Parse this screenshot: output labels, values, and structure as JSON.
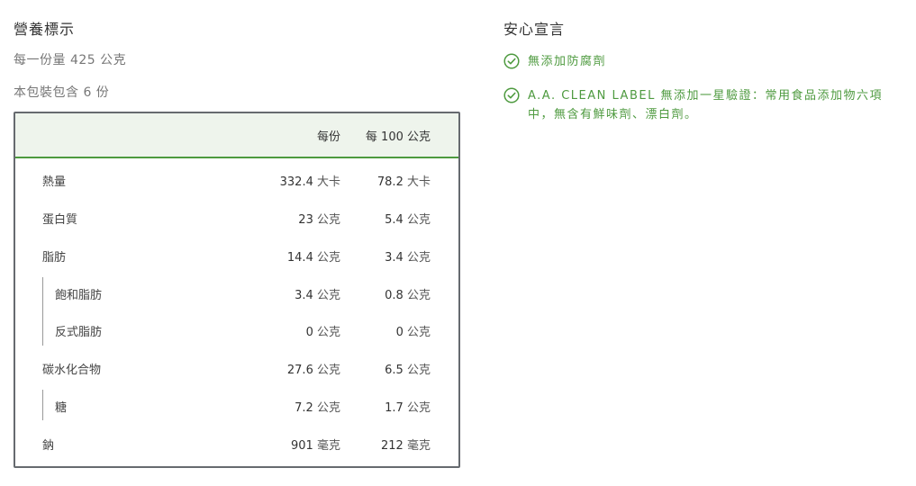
{
  "nutrition": {
    "title": "營養標示",
    "serving_size": "每一份量 425 公克",
    "servings": "本包裝包含 6 份",
    "headers": {
      "per_serving": "每份",
      "per_100g": "每 100 公克"
    },
    "rows": [
      {
        "name": "熱量",
        "per_serving": "332.4",
        "per_serving_unit": "大卡",
        "per_100g": "78.2",
        "per_100g_unit": "大卡"
      },
      {
        "name": "蛋白質",
        "per_serving": "23",
        "per_serving_unit": "公克",
        "per_100g": "5.4",
        "per_100g_unit": "公克"
      },
      {
        "name": "脂肪",
        "per_serving": "14.4",
        "per_serving_unit": "公克",
        "per_100g": "3.4",
        "per_100g_unit": "公克"
      },
      {
        "name": "飽和脂肪",
        "per_serving": "3.4",
        "per_serving_unit": "公克",
        "per_100g": "0.8",
        "per_100g_unit": "公克"
      },
      {
        "name": "反式脂肪",
        "per_serving": "0",
        "per_serving_unit": "公克",
        "per_100g": "0",
        "per_100g_unit": "公克"
      },
      {
        "name": "碳水化合物",
        "per_serving": "27.6",
        "per_serving_unit": "公克",
        "per_100g": "6.5",
        "per_100g_unit": "公克"
      },
      {
        "name": "糖",
        "per_serving": "7.2",
        "per_serving_unit": "公克",
        "per_100g": "1.7",
        "per_100g_unit": "公克"
      },
      {
        "name": "鈉",
        "per_serving": "901",
        "per_serving_unit": "毫克",
        "per_100g": "212",
        "per_100g_unit": "毫克"
      }
    ]
  },
  "claims": {
    "title": "安心宣言",
    "items": [
      {
        "text": "無添加防腐劑",
        "icon": "check-circle-icon"
      },
      {
        "text": "A.A. CLEAN LABEL 無添加一星驗證：常用食品添加物六項中，無含有鮮味劑、漂白劑。",
        "icon": "check-circle-icon"
      }
    ],
    "accent": "#4e9a3f"
  },
  "colors": {
    "header_bg": "#eef4ec",
    "header_border": "#4d9a3e",
    "table_border": "#666a6f"
  }
}
